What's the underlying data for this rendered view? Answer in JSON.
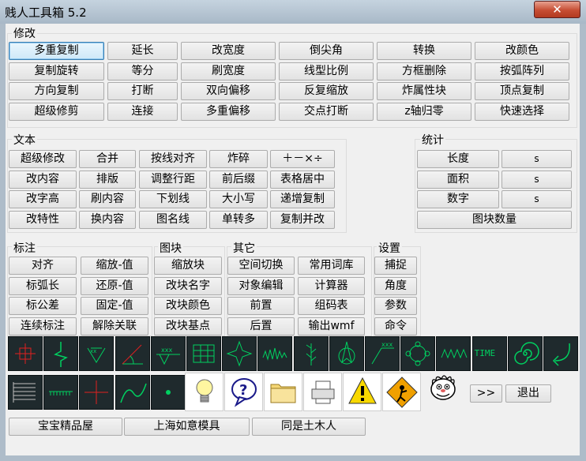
{
  "window": {
    "title": "贱人工具箱 5.2",
    "close_glyph": "✕"
  },
  "modify": {
    "label": "修改",
    "buttons": [
      "多重复制",
      "延长",
      "改宽度",
      "倒尖角",
      "转换",
      "改颜色",
      "复制旋转",
      "等分",
      "刷宽度",
      "线型比例",
      "方框删除",
      "按弧阵列",
      "方向复制",
      "打断",
      "双向偏移",
      "反复缩放",
      "炸属性块",
      "顶点复制",
      "超级修剪",
      "连接",
      "多重偏移",
      "交点打断",
      "z轴归零",
      "快速选择"
    ]
  },
  "text": {
    "label": "文本",
    "buttons": [
      "超级修改",
      "合并",
      "按线对齐",
      "炸碎",
      "＋－×÷",
      "改内容",
      "排版",
      "调整行距",
      "前后缀",
      "表格居中",
      "改字高",
      "刷内容",
      "下划线",
      "大小写",
      "递增复制",
      "改特性",
      "换内容",
      "图名线",
      "单转多",
      "复制并改"
    ]
  },
  "stats": {
    "label": "统计",
    "rows": [
      {
        "name": "长度",
        "value": "s"
      },
      {
        "name": "面积",
        "value": "s"
      },
      {
        "name": "数字",
        "value": "s"
      }
    ],
    "block_count": "图块数量"
  },
  "dim": {
    "label": "标注",
    "buttons": [
      "对齐",
      "缩放-值",
      "标弧长",
      "还原-值",
      "标公差",
      "固定-值",
      "连续标注",
      "解除关联"
    ]
  },
  "block": {
    "label": "图块",
    "buttons": [
      "缩放块",
      "改块名字",
      "改块颜色",
      "改块基点"
    ]
  },
  "other": {
    "label": "其它",
    "buttons": [
      "空间切换",
      "常用词库",
      "对象编辑",
      "计算器",
      "前置",
      "组码表",
      "后置",
      "输出wmf"
    ]
  },
  "settings": {
    "label": "设置",
    "buttons": [
      "捕捉",
      "角度",
      "参数",
      "命令"
    ]
  },
  "tools_row1": [
    {
      "icon": "crosshair-box-icon"
    },
    {
      "icon": "break-line-icon"
    },
    {
      "icon": "weld-symbol-icon"
    },
    {
      "icon": "angle-icon"
    },
    {
      "icon": "leader-xxx-icon"
    },
    {
      "icon": "grid-table-icon"
    },
    {
      "icon": "star-icon"
    },
    {
      "icon": "wave-lines-icon"
    },
    {
      "icon": "tree-icon"
    },
    {
      "icon": "north-arrow-icon"
    },
    {
      "icon": "slope-xxx-icon"
    },
    {
      "icon": "gear-cloud-icon"
    },
    {
      "icon": "zigzag-icon"
    },
    {
      "icon": "time-text-icon",
      "text": "TIME"
    },
    {
      "icon": "spiral-icon"
    },
    {
      "icon": "return-arrow-icon"
    }
  ],
  "tools_row2": [
    {
      "icon": "spring-lines-icon"
    },
    {
      "icon": "ground-hatch-icon"
    },
    {
      "icon": "red-cross-icon"
    },
    {
      "icon": "curve-icon"
    },
    {
      "icon": "green-dot-icon"
    }
  ],
  "tools_color": [
    {
      "icon": "lightbulb-icon"
    },
    {
      "icon": "help-bubble-icon"
    },
    {
      "icon": "folder-icon"
    },
    {
      "icon": "printer-icon"
    },
    {
      "icon": "warning-icon"
    },
    {
      "icon": "construction-icon"
    }
  ],
  "mascot_icon": "cartoon-face-icon",
  "nav": {
    "more": ">>",
    "exit": "退出"
  },
  "links": [
    "宝宝精品屋",
    "上海如意模具",
    "同是土木人"
  ],
  "colors": {
    "tile_bg": "#1f2a2d",
    "tile_fg": "#00d060",
    "accent_red": "#e02020"
  }
}
